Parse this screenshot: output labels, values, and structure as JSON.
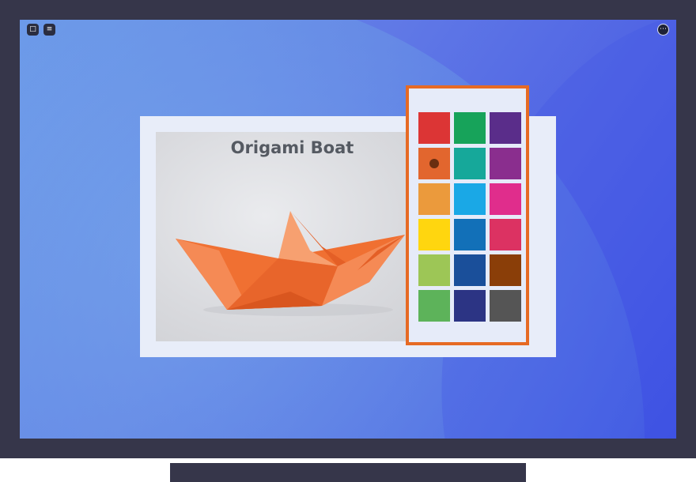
{
  "card": {
    "title": "Origami Boat"
  },
  "icons": {
    "top_left": [
      "app-icon",
      "notes-icon"
    ],
    "top_right": "more-options-icon"
  },
  "palette": {
    "selected_index": 3,
    "colors": [
      "#dc3535",
      "#17a35a",
      "#5a2d8a",
      "#e2662e",
      "#16a89a",
      "#8a2e8e",
      "#eb9a3c",
      "#1aa8e6",
      "#e02d8c",
      "#ffd60f",
      "#1270b8",
      "#dc3262",
      "#9dc656",
      "#1a4f9a",
      "#8a3e08",
      "#5db35a",
      "#2c3484",
      "#555555"
    ],
    "border_color": "#e66a24"
  },
  "boat_color": "#f07032"
}
